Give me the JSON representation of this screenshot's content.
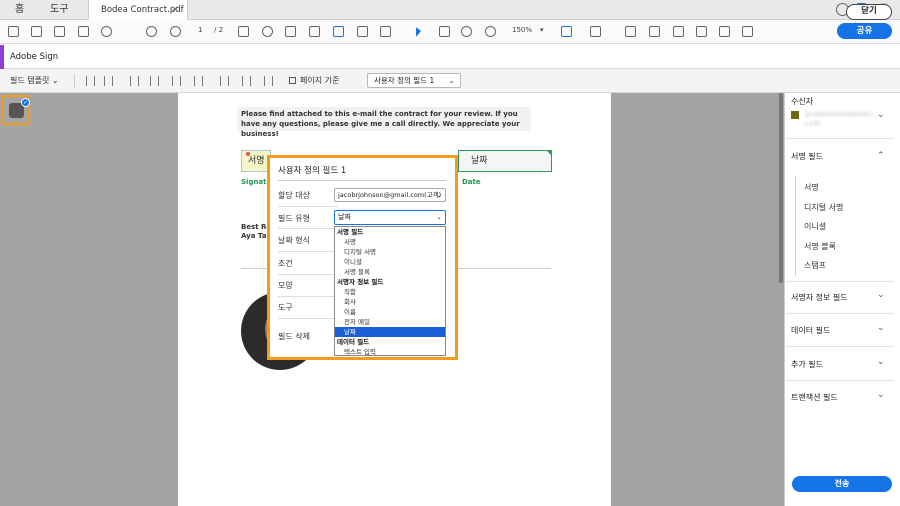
{
  "tabs": {
    "home": "홈",
    "tools": "도구",
    "document": "Bodea Contract.pdf",
    "close_glyph": "×"
  },
  "toolbar": {
    "page_current": "1",
    "page_total": "/ 2",
    "zoom": "150%",
    "zoom_caret": "▾",
    "share_label": "공유",
    "icons": [
      "save-icon",
      "upload-icon",
      "print-icon",
      "mail-icon",
      "search-icon",
      "page-up-icon",
      "page-down-icon",
      "zoom-in-icon",
      "zoom-out-icon",
      "hand-icon",
      "select-cursor-icon",
      "comment-icon",
      "highlight-icon",
      "image-icon",
      "rectangle-icon",
      "text-icon",
      "signature-icon"
    ]
  },
  "signbar": {
    "title": "Adobe Sign",
    "close_label": "닫기"
  },
  "fieldbar": {
    "template_label": "필드 템플릿",
    "page_base_label": "페이지 기준",
    "custom_field_select": "사용자 정의 필드 1"
  },
  "document": {
    "note": "Please find attached to this e-mail the contract for your review. If you have any questions, please give me a call directly. We appreciate your business!",
    "sig_field": "서명",
    "date_field": "날짜",
    "sig_caption": "Signatu",
    "date_caption": "Date",
    "best": "Best Re",
    "name": "Aya Ta"
  },
  "popup": {
    "title": "사용자 정의 필드 1",
    "assignee_label": "할당 대상",
    "assignee_value": "jacobrjohnson@gmail.com(고객)",
    "field_type_label": "필드 유형",
    "field_type_value": "날짜",
    "date_format_label": "날짜 형식",
    "condition_label": "조건",
    "appearance_label": "모양",
    "tools_label": "도구",
    "delete_label": "필드 삭제",
    "dropdown": [
      {
        "text": "서명 필드",
        "group": true
      },
      {
        "text": "서명"
      },
      {
        "text": "디지털 서명"
      },
      {
        "text": "이니셜"
      },
      {
        "text": "서명 블록"
      },
      {
        "text": "서명자 정보 필드",
        "group": true
      },
      {
        "text": "직함"
      },
      {
        "text": "회사"
      },
      {
        "text": "이름"
      },
      {
        "text": "전자 메일"
      },
      {
        "text": "날짜",
        "selected": true
      },
      {
        "text": "데이터 필드",
        "group": true
      },
      {
        "text": "텍스트 입력"
      }
    ]
  },
  "right_panel": {
    "recipient_label": "수신자",
    "recipient_value": "jacobrjohnson@gmail.com (고객)",
    "signature_fields": "서명 필드",
    "sub_items": [
      "서명",
      "디지털 서명",
      "이니셜",
      "서명 블록",
      "스탬프"
    ],
    "signer_info_fields": "서명자 정보 필드",
    "data_fields": "데이터 필드",
    "additional_fields": "추가 필드",
    "transaction_fields": "트랜잭션 필드",
    "send_label": "전송",
    "chevron_down": "⌄",
    "chevron_up": "⌃"
  },
  "colors": {
    "accent": "#1473e6",
    "highlight": "#f29b1c",
    "sign_accent": "#8c41d2",
    "date_border": "#2e9a5a"
  }
}
